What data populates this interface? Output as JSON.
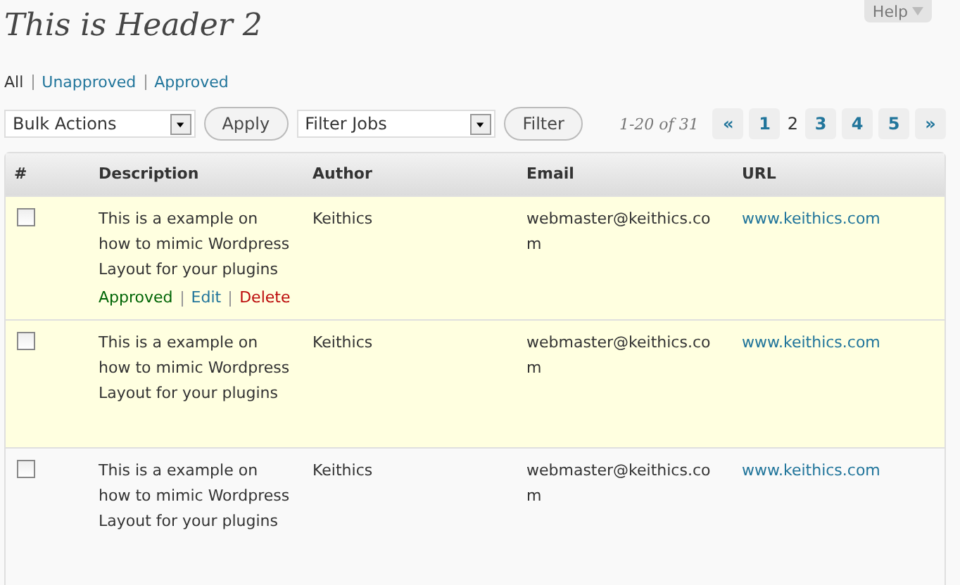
{
  "header": {
    "title": "This is Header 2",
    "help": "Help"
  },
  "filters": [
    {
      "label": "All",
      "selected": true
    },
    {
      "label": "Unapproved",
      "selected": false
    },
    {
      "label": "Approved",
      "selected": false
    }
  ],
  "toolbar": {
    "bulk_select": "Bulk Actions",
    "apply": "Apply",
    "filter_select": "Filter Jobs",
    "filter": "Filter",
    "count": "1-20 of 31",
    "pages": [
      {
        "label": "«",
        "selected": false
      },
      {
        "label": "1",
        "selected": false
      },
      {
        "label": "2",
        "selected": true
      },
      {
        "label": "3",
        "selected": false
      },
      {
        "label": "4",
        "selected": false
      },
      {
        "label": "5",
        "selected": false
      },
      {
        "label": "»",
        "selected": false
      }
    ]
  },
  "table": {
    "columns": [
      "#",
      "Description",
      "Author",
      "Email",
      "URL"
    ],
    "rows": [
      {
        "checked": false,
        "highlighted": true,
        "description": "This is a example on how to mimic Wordpress Layout for your plugins",
        "author": "Keithics",
        "email": "webmaster@keithics.com",
        "url": "www.keithics.com",
        "actions": [
          {
            "label": "Approved",
            "kind": "approve"
          },
          {
            "label": "Edit",
            "kind": "edit"
          },
          {
            "label": "Delete",
            "kind": "delete"
          }
        ]
      },
      {
        "checked": false,
        "highlighted": true,
        "description": "This is a example on how to mimic Wordpress Layout for your plugins",
        "author": "Keithics",
        "email": "webmaster@keithics.com",
        "url": "www.keithics.com"
      },
      {
        "checked": false,
        "highlighted": false,
        "description": "This is a example on how to mimic Wordpress Layout for your plugins",
        "author": "Keithics",
        "email": "webmaster@keithics.com",
        "url": "www.keithics.com"
      }
    ]
  }
}
